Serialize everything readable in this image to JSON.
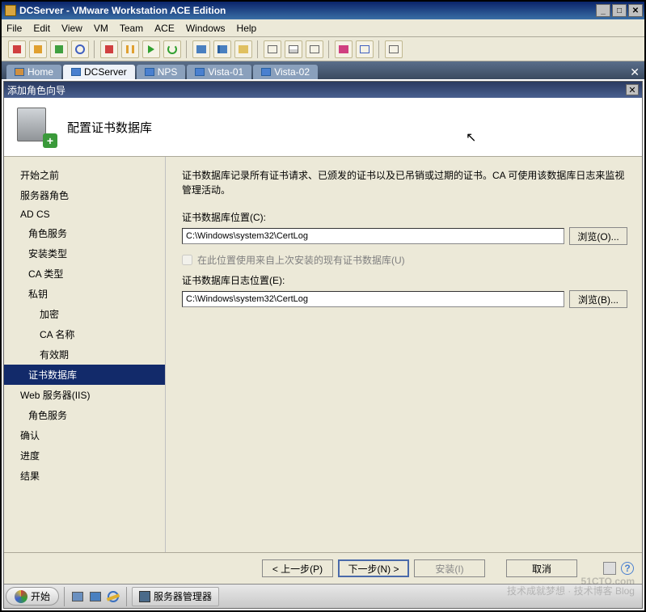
{
  "vmware": {
    "title": "DCServer - VMware Workstation ACE Edition",
    "menu": [
      "File",
      "Edit",
      "View",
      "VM",
      "Team",
      "ACE",
      "Windows",
      "Help"
    ],
    "tabs": [
      {
        "label": "Home",
        "key": "home"
      },
      {
        "label": "DCServer",
        "key": "dcserver",
        "active": true
      },
      {
        "label": "NPS",
        "key": "nps"
      },
      {
        "label": "Vista-01",
        "key": "vista01"
      },
      {
        "label": "Vista-02",
        "key": "vista02"
      }
    ]
  },
  "wizard": {
    "window_title": "添加角色向导",
    "header_title": "配置证书数据库",
    "description": "证书数据库记录所有证书请求、已颁发的证书以及已吊销或过期的证书。CA 可使用该数据库日志来监视管理活动。",
    "db_location_label": "证书数据库位置(C):",
    "db_location_value": "C:\\Windows\\system32\\CertLog",
    "browse_d": "浏览(O)...",
    "reuse_label": "在此位置使用来自上次安装的现有证书数据库(U)",
    "log_location_label": "证书数据库日志位置(E):",
    "log_location_value": "C:\\Windows\\system32\\CertLog",
    "browse_b": "浏览(B)...",
    "nav": {
      "before": "开始之前",
      "server_roles": "服务器角色",
      "adcs": "AD CS",
      "role_services": "角色服务",
      "setup_type": "安装类型",
      "ca_type": "CA 类型",
      "private_key": "私钥",
      "encryption": "加密",
      "ca_name": "CA 名称",
      "validity": "有效期",
      "cert_db": "证书数据库",
      "iis": "Web 服务器(IIS)",
      "iis_role_services": "角色服务",
      "confirm": "确认",
      "progress": "进度",
      "results": "结果"
    },
    "buttons": {
      "prev": "< 上一步(P)",
      "next": "下一步(N) >",
      "install": "安装(I)",
      "cancel": "取消"
    }
  },
  "taskbar": {
    "start": "开始",
    "server_manager": "服务器管理器"
  },
  "watermark": {
    "main": "51CTO.com",
    "sub": "技术成就梦想 · 技术博客 Blog"
  }
}
